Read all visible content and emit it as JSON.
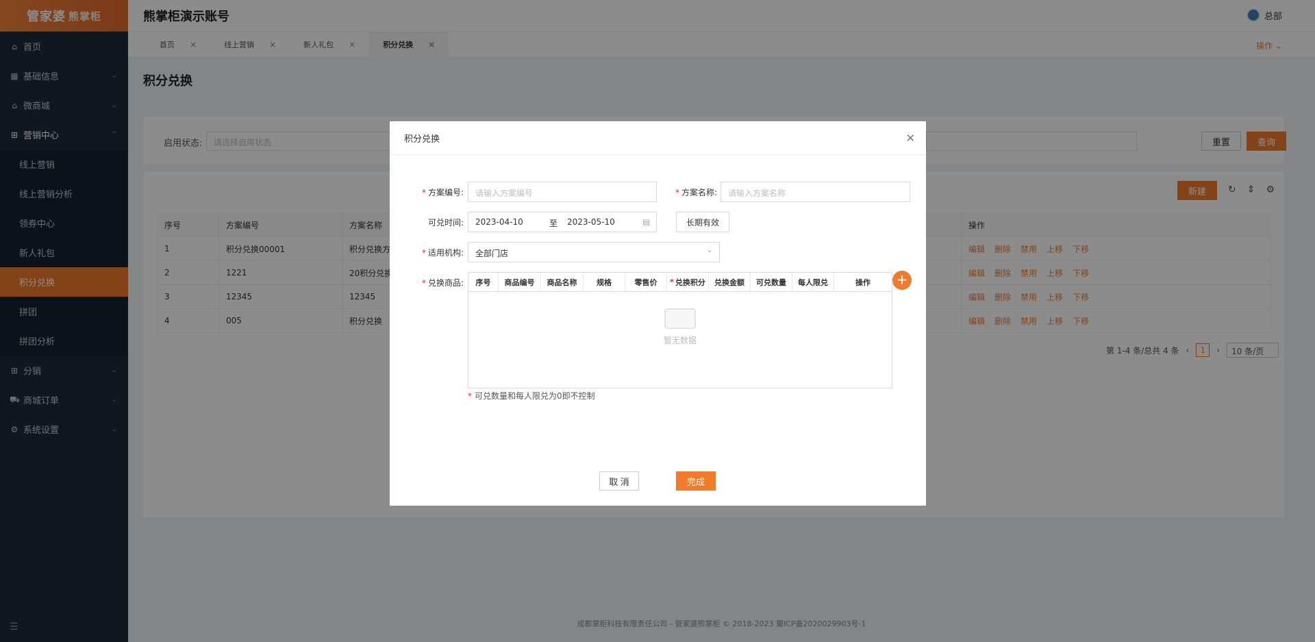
{
  "logo": {
    "text": "管家婆",
    "sub": "熊掌柜"
  },
  "sidebar": {
    "items": [
      {
        "label": "首页",
        "icon": "home-icon"
      },
      {
        "label": "基础信息",
        "icon": "grid-icon"
      },
      {
        "label": "微商城",
        "icon": "shop-icon"
      },
      {
        "label": "营销中心",
        "icon": "gift-icon"
      }
    ],
    "sub_items": [
      {
        "label": "线上营销"
      },
      {
        "label": "线上营销分析"
      },
      {
        "label": "领券中心"
      },
      {
        "label": "新人礼包"
      },
      {
        "label": "积分兑换"
      },
      {
        "label": "拼团"
      },
      {
        "label": "拼团分析"
      }
    ],
    "more_items": [
      {
        "label": "分销",
        "icon": "gift-icon"
      },
      {
        "label": "商城订单",
        "icon": "cart-icon"
      },
      {
        "label": "系统设置",
        "icon": "gear-icon"
      }
    ]
  },
  "header": {
    "title": "熊掌柜演示账号",
    "user": "总部"
  },
  "tabs": [
    {
      "label": "首页"
    },
    {
      "label": "线上营销"
    },
    {
      "label": "新人礼包"
    },
    {
      "label": "积分兑换"
    }
  ],
  "ops_label": "操作",
  "page": {
    "title": "积分兑换"
  },
  "filter": {
    "label": "启用状态:",
    "placeholder": "请选择启用状态",
    "reset": "重置",
    "query": "查询"
  },
  "table": {
    "new_label": "新建",
    "headers": [
      "序号",
      "方案编号",
      "方案名称",
      "操作"
    ],
    "rows": [
      {
        "no": "1",
        "code": "积分兑换00001",
        "name": "积分兑换方"
      },
      {
        "no": "2",
        "code": "1221",
        "name": "20积分兑换"
      },
      {
        "no": "3",
        "code": "12345",
        "name": "12345"
      },
      {
        "no": "4",
        "code": "005",
        "name": "积分兑换"
      }
    ],
    "actions": [
      "编辑",
      "删除",
      "禁用",
      "上移",
      "下移"
    ]
  },
  "pagination": {
    "summary": "第 1-4 条/总共 4 条",
    "current": "1",
    "size": "10 条/页"
  },
  "footer": "成都掌柜科技有限责任公司 - 管家婆熊掌柜 © 2018-2023 蜀ICP备2020029903号-1",
  "modal": {
    "title": "积分兑换",
    "code_label": "方案编号:",
    "code_placeholder": "请输入方案编号",
    "name_label": "方案名称:",
    "name_placeholder": "请输入方案名称",
    "time_label": "可兑时间:",
    "date_start": "2023-04-10",
    "date_sep": "至",
    "date_end": "2023-05-10",
    "long_term": "长期有效",
    "org_label": "适用机构:",
    "org_value": "全部门店",
    "goods_label": "兑换商品:",
    "goods_columns": [
      "序号",
      "商品编号",
      "商品名称",
      "规格",
      "零售价",
      "兑换积分",
      "兑换金额",
      "可兑数量",
      "每人限兑",
      "操作"
    ],
    "empty_text": "暂无数据",
    "hint": "可兑数量和每人限兑为0即不控制",
    "cancel": "取 消",
    "done": "完成"
  }
}
